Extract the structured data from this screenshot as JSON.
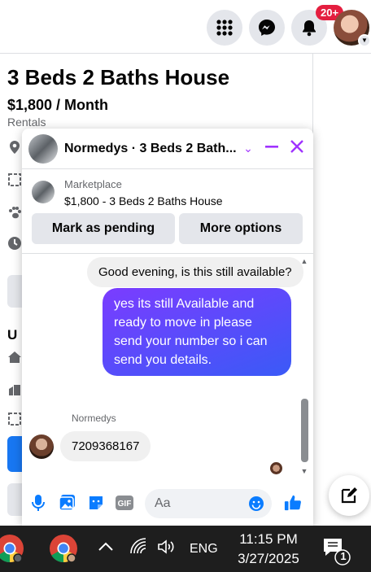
{
  "topbar": {
    "icons": [
      "menu-grid-icon",
      "messenger-icon",
      "notifications-bell-icon"
    ],
    "notification_badge": "20+"
  },
  "listing": {
    "title": "3 Beds 2 Baths House",
    "price": "$1,800 / Month",
    "category": "Rentals",
    "section_heading": "U"
  },
  "chat": {
    "title": "Normedys · 3 Beds 2 Bath...",
    "marketplace_label": "Marketplace",
    "marketplace_item": "$1,800 - 3 Beds 2 Baths House",
    "mark_pending_label": "Mark as pending",
    "more_options_label": "More options",
    "messages": {
      "incoming_top": "Good evening, is this still available?",
      "outgoing": "yes its still Available and ready to move in please send your number so i can send you details.",
      "sender_name": "Normedys",
      "incoming_reply": "7209368167"
    },
    "composer": {
      "placeholder": "Aa"
    },
    "colors": {
      "accent": "#a033ff",
      "bubble_start": "#7b3cff",
      "bubble_end": "#3a5af7",
      "like": "#0a7cff"
    }
  },
  "taskbar": {
    "language": "ENG",
    "time": "11:15 PM",
    "date": "3/27/2025",
    "notification_count": "1"
  }
}
